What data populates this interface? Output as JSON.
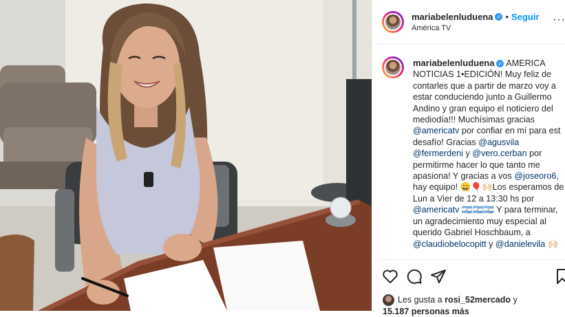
{
  "post": {
    "username": "mariabelenluduena",
    "follow_label": "Seguir",
    "location": "América TV",
    "separator": "•",
    "more_label": "···",
    "caption_segments": [
      {
        "t": "AMERICA NOTICIAS 1•EDICIÓN! Muy feliz de contarles que a partir de marzo voy a estar conduciendo junto a Guillermo Andino y gran equipo el noticiero del mediodía!!! Muchísimas gracias ",
        "m": false
      },
      {
        "t": "@americatv",
        "m": true
      },
      {
        "t": " por confiar en mí para est desafío! Gracias ",
        "m": false
      },
      {
        "t": "@agusvila",
        "m": true
      },
      {
        "t": " ",
        "m": false
      },
      {
        "t": "@fermerdeni",
        "m": true
      },
      {
        "t": " y ",
        "m": false
      },
      {
        "t": "@vero.cerban",
        "m": true
      },
      {
        "t": " por permitirme hacer lo que tanto me apasiona! Y gracias a vos ",
        "m": false
      },
      {
        "t": "@joseoro6",
        "m": true
      },
      {
        "t": ", hay equipo! 😀🎈🙌🏻Los esperamos de Lun a Vier de 12 a 13:30 hs por ",
        "m": false
      },
      {
        "t": "@americatv",
        "m": true
      },
      {
        "t": " 🇦🇷🇦🇷🇦🇷 Y para terminar, un agradecimiento muy especial al querido Gabriel Hoschbaum, a ",
        "m": false
      },
      {
        "t": "@claudiobelocopitt",
        "m": true
      },
      {
        "t": " y ",
        "m": false
      },
      {
        "t": "@danielevila",
        "m": true
      },
      {
        "t": " 🙌🏻",
        "m": false
      }
    ],
    "likes": {
      "prefix": "Les gusta a ",
      "user": "rosi_52mercado",
      "middle": " y ",
      "count": "15.187 personas más"
    }
  },
  "colors": {
    "link": "#0095f6",
    "mention": "#00376b",
    "verified": "#3897f0"
  },
  "icons": [
    "heart-icon",
    "comment-icon",
    "share-icon",
    "bookmark-icon",
    "verified-badge-icon",
    "more-options-icon"
  ]
}
